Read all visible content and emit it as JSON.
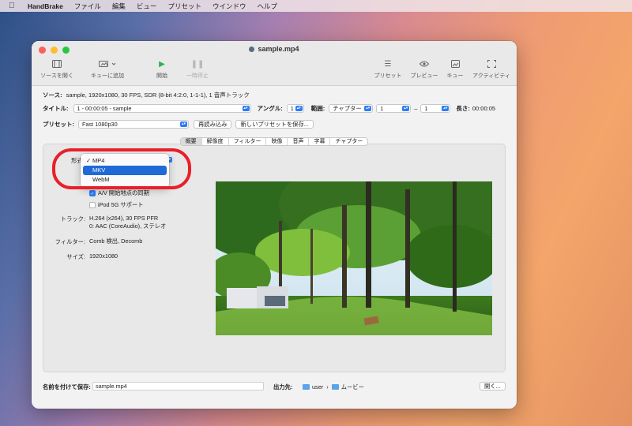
{
  "menubar": {
    "app": "HandBrake",
    "items": [
      "ファイル",
      "編集",
      "ビュー",
      "プリセット",
      "ウインドウ",
      "ヘルプ"
    ]
  },
  "window": {
    "title": "sample.mp4"
  },
  "toolbar": {
    "open_source": "ソースを開く",
    "add_queue": "キューに追加",
    "start": "開始",
    "pause": "一時停止",
    "presets": "プリセット",
    "preview": "プレビュー",
    "queue": "キュー",
    "activity": "アクティビティ"
  },
  "source": {
    "label": "ソース:",
    "value": "sample, 1920x1080, 30 FPS, SDR (8-bit 4:2:0, 1-1-1), 1 音声トラック"
  },
  "title_row": {
    "label": "タイトル:",
    "value": "1 - 00:00:05 - sample",
    "angle_label": "アングル:",
    "angle_value": "1",
    "range_label": "範囲:",
    "range_type": "チャプター",
    "range_from": "1",
    "range_dash": "–",
    "range_to": "1",
    "duration_label": "長さ:",
    "duration_value": "00:00:05"
  },
  "preset_row": {
    "label": "プリセット:",
    "value": "Fast 1080p30",
    "reload": "再読み込み",
    "save_new": "新しいプリセットを保存..."
  },
  "tabs": [
    "概要",
    "解像度",
    "フィルター",
    "映像",
    "音声",
    "字幕",
    "チャプター"
  ],
  "summary": {
    "format_label": "形式",
    "format_options": [
      "MP4",
      "MKV",
      "WebM"
    ],
    "format_selected": "MP4",
    "format_highlighted": "MKV",
    "av_sync": "A/V 開始地点の同期",
    "av_sync_checked": true,
    "ipod": "iPod 5G サポート",
    "ipod_checked": false,
    "tracks_label": "トラック:",
    "tracks_line1": "H.264 (x264), 30 FPS PFR",
    "tracks_line2": "0: AAC (CoreAudio), ステレオ",
    "filters_label": "フィルター:",
    "filters_value": "Comb 検出, Decomb",
    "size_label": "サイズ:",
    "size_value": "1920x1080"
  },
  "save": {
    "label": "名前を付けて保存:",
    "value": "sample.mp4",
    "dest_label": "出力先:",
    "dest_user": "user",
    "dest_sep": "›",
    "dest_folder": "ムービー",
    "open": "開く..."
  },
  "colors": {
    "accent": "#2d7cf6",
    "highlight": "#1f6ad6",
    "annotation": "#e8202a"
  }
}
